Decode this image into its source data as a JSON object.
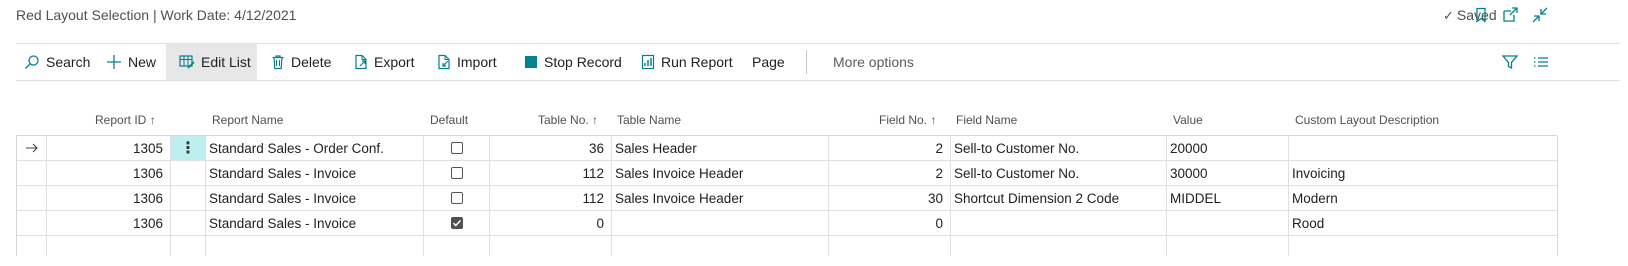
{
  "header": {
    "title": "Red Layout Selection | Work Date: 4/12/2021",
    "saved_label": "Saved",
    "icons": [
      "bookmark-icon",
      "open-new-window-icon",
      "collapse-icon"
    ]
  },
  "actions": {
    "search": "Search",
    "new": "New",
    "edit_list": "Edit List",
    "delete": "Delete",
    "export": "Export",
    "import": "Import",
    "stop_record": "Stop Record",
    "run_report": "Run Report",
    "page": "Page",
    "more_options": "More options"
  },
  "columns": {
    "report_id": "Report ID",
    "report_name": "Report Name",
    "default": "Default",
    "table_no": "Table No.",
    "table_name": "Table Name",
    "field_no": "Field No.",
    "field_name": "Field Name",
    "value": "Value",
    "custom_layout_description": "Custom Layout Description"
  },
  "rows": [
    {
      "report_id": "1305",
      "report_name": "Standard Sales - Order Conf.",
      "default": false,
      "table_no": "36",
      "table_name": "Sales Header",
      "field_no": "2",
      "field_name": "Sell-to Customer No.",
      "value": "20000",
      "custom_layout_description": ""
    },
    {
      "report_id": "1306",
      "report_name": "Standard Sales - Invoice",
      "default": false,
      "table_no": "112",
      "table_name": "Sales Invoice Header",
      "field_no": "2",
      "field_name": "Sell-to Customer No.",
      "value": "30000",
      "custom_layout_description": "Invoicing"
    },
    {
      "report_id": "1306",
      "report_name": "Standard Sales - Invoice",
      "default": false,
      "table_no": "112",
      "table_name": "Sales Invoice Header",
      "field_no": "30",
      "field_name": "Shortcut Dimension 2 Code",
      "value": "MIDDEL",
      "custom_layout_description": "Modern"
    },
    {
      "report_id": "1306",
      "report_name": "Standard Sales - Invoice",
      "default": true,
      "table_no": "0",
      "table_name": "",
      "field_no": "0",
      "field_name": "",
      "value": "",
      "custom_layout_description": "Rood"
    }
  ],
  "colors": {
    "accent": "#00838f",
    "selected_row_marker": "#bdeff1",
    "active_action_bg": "#e7e7e7"
  }
}
